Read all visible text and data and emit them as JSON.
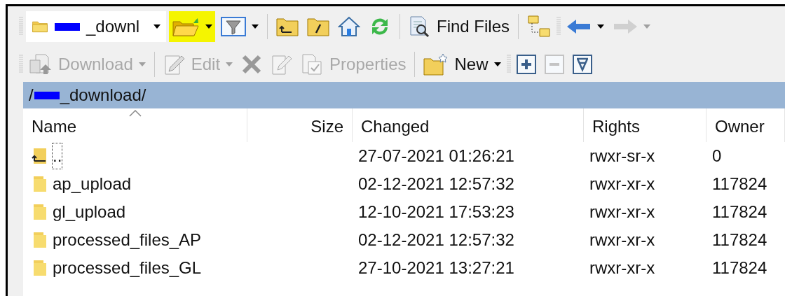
{
  "toolbar_top": {
    "location": {
      "text": "_downl",
      "redacted": true
    },
    "items": [
      {
        "kind": "open",
        "highlighted": true,
        "dropdown": true
      },
      {
        "kind": "filter",
        "dropdown": true
      },
      {
        "kind": "sep"
      },
      {
        "kind": "parent"
      },
      {
        "kind": "root"
      },
      {
        "kind": "home"
      },
      {
        "kind": "refresh"
      },
      {
        "kind": "sep"
      },
      {
        "kind": "find",
        "label": "Find Files"
      },
      {
        "kind": "sep"
      },
      {
        "kind": "tree"
      },
      {
        "kind": "grip"
      },
      {
        "kind": "back",
        "disabled": false,
        "dropdown": true
      },
      {
        "kind": "forward",
        "disabled": true,
        "dropdown": true
      }
    ]
  },
  "toolbar_bottom": {
    "items": [
      {
        "kind": "grip"
      },
      {
        "kind": "download",
        "label": "Download",
        "disabled": true,
        "dropdown": true
      },
      {
        "kind": "sep"
      },
      {
        "kind": "edit",
        "label": "Edit",
        "disabled": true,
        "dropdown": true
      },
      {
        "kind": "delete",
        "disabled": true
      },
      {
        "kind": "rename",
        "disabled": true
      },
      {
        "kind": "properties",
        "label": "Properties",
        "disabled": true
      },
      {
        "kind": "sep"
      },
      {
        "kind": "new",
        "label": "New",
        "disabled": false,
        "dropdown": true
      },
      {
        "kind": "grip"
      },
      {
        "kind": "plus",
        "disabled": false
      },
      {
        "kind": "minus",
        "disabled": true
      },
      {
        "kind": "selectall",
        "disabled": false
      }
    ]
  },
  "path_bar": {
    "prefix": "/",
    "redacted": true,
    "text": "_download/"
  },
  "table": {
    "columns": [
      {
        "label": "Name",
        "sorted": true
      },
      {
        "label": "Size",
        "sorted": false
      },
      {
        "label": "Changed",
        "sorted": false
      },
      {
        "label": "Rights",
        "sorted": false
      },
      {
        "label": "Owner",
        "sorted": false
      }
    ],
    "rows": [
      {
        "kind": "parent",
        "name": "..",
        "focused": true,
        "changed": "27-07-2021 01:26:21",
        "rights": "rwxr-sr-x",
        "owner": "0"
      },
      {
        "kind": "folder",
        "name": "ap_upload",
        "focused": false,
        "changed": "02-12-2021 12:57:32",
        "rights": "rwxr-xr-x",
        "owner": "117824"
      },
      {
        "kind": "folder",
        "name": "gl_upload",
        "focused": false,
        "changed": "12-10-2021 17:53:23",
        "rights": "rwxr-xr-x",
        "owner": "117824"
      },
      {
        "kind": "folder",
        "name": "processed_files_AP",
        "focused": false,
        "changed": "02-12-2021 12:57:32",
        "rights": "rwxr-xr-x",
        "owner": "117824"
      },
      {
        "kind": "folder",
        "name": "processed_files_GL",
        "focused": false,
        "changed": "27-10-2021 13:27:21",
        "rights": "rwxr-xr-x",
        "owner": "117824"
      }
    ]
  }
}
